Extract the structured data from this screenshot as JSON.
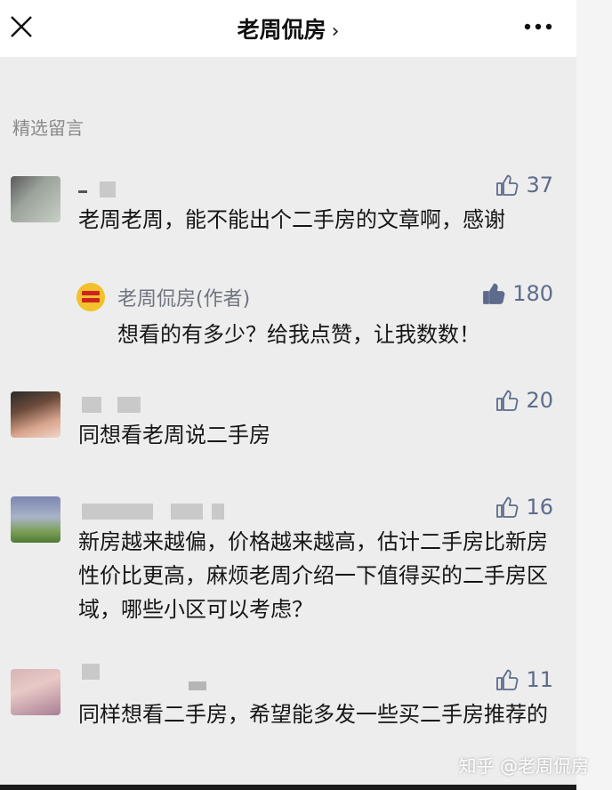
{
  "header": {
    "title": "老周侃房",
    "chevron": "›",
    "close_icon": "close-icon",
    "more_icon": "more-icon"
  },
  "section_title": "精选留言",
  "comments": [
    {
      "likes": "37",
      "text": "老周老周，能不能出个二手房的文章啊，感谢",
      "reply": {
        "author": "老周侃房(作者)",
        "likes": "180",
        "text": "想看的有多少？给我点赞，让我数数！"
      }
    },
    {
      "likes": "20",
      "text": "同想看老周说二手房"
    },
    {
      "likes": "16",
      "text": "新房越来越偏，价格越来越高，估计二手房比新房性价比更高，麻烦老周介绍一下值得买的二手房区域，哪些小区可以考虑？"
    },
    {
      "likes": "11",
      "text": "同样想看二手房，希望能多发一些买二手房推荐的"
    }
  ],
  "watermark": "知乎 @老周侃房",
  "colors": {
    "like_blue": "#5e6b8c",
    "background": "#ededed",
    "author_badge": "#f3c12b"
  }
}
